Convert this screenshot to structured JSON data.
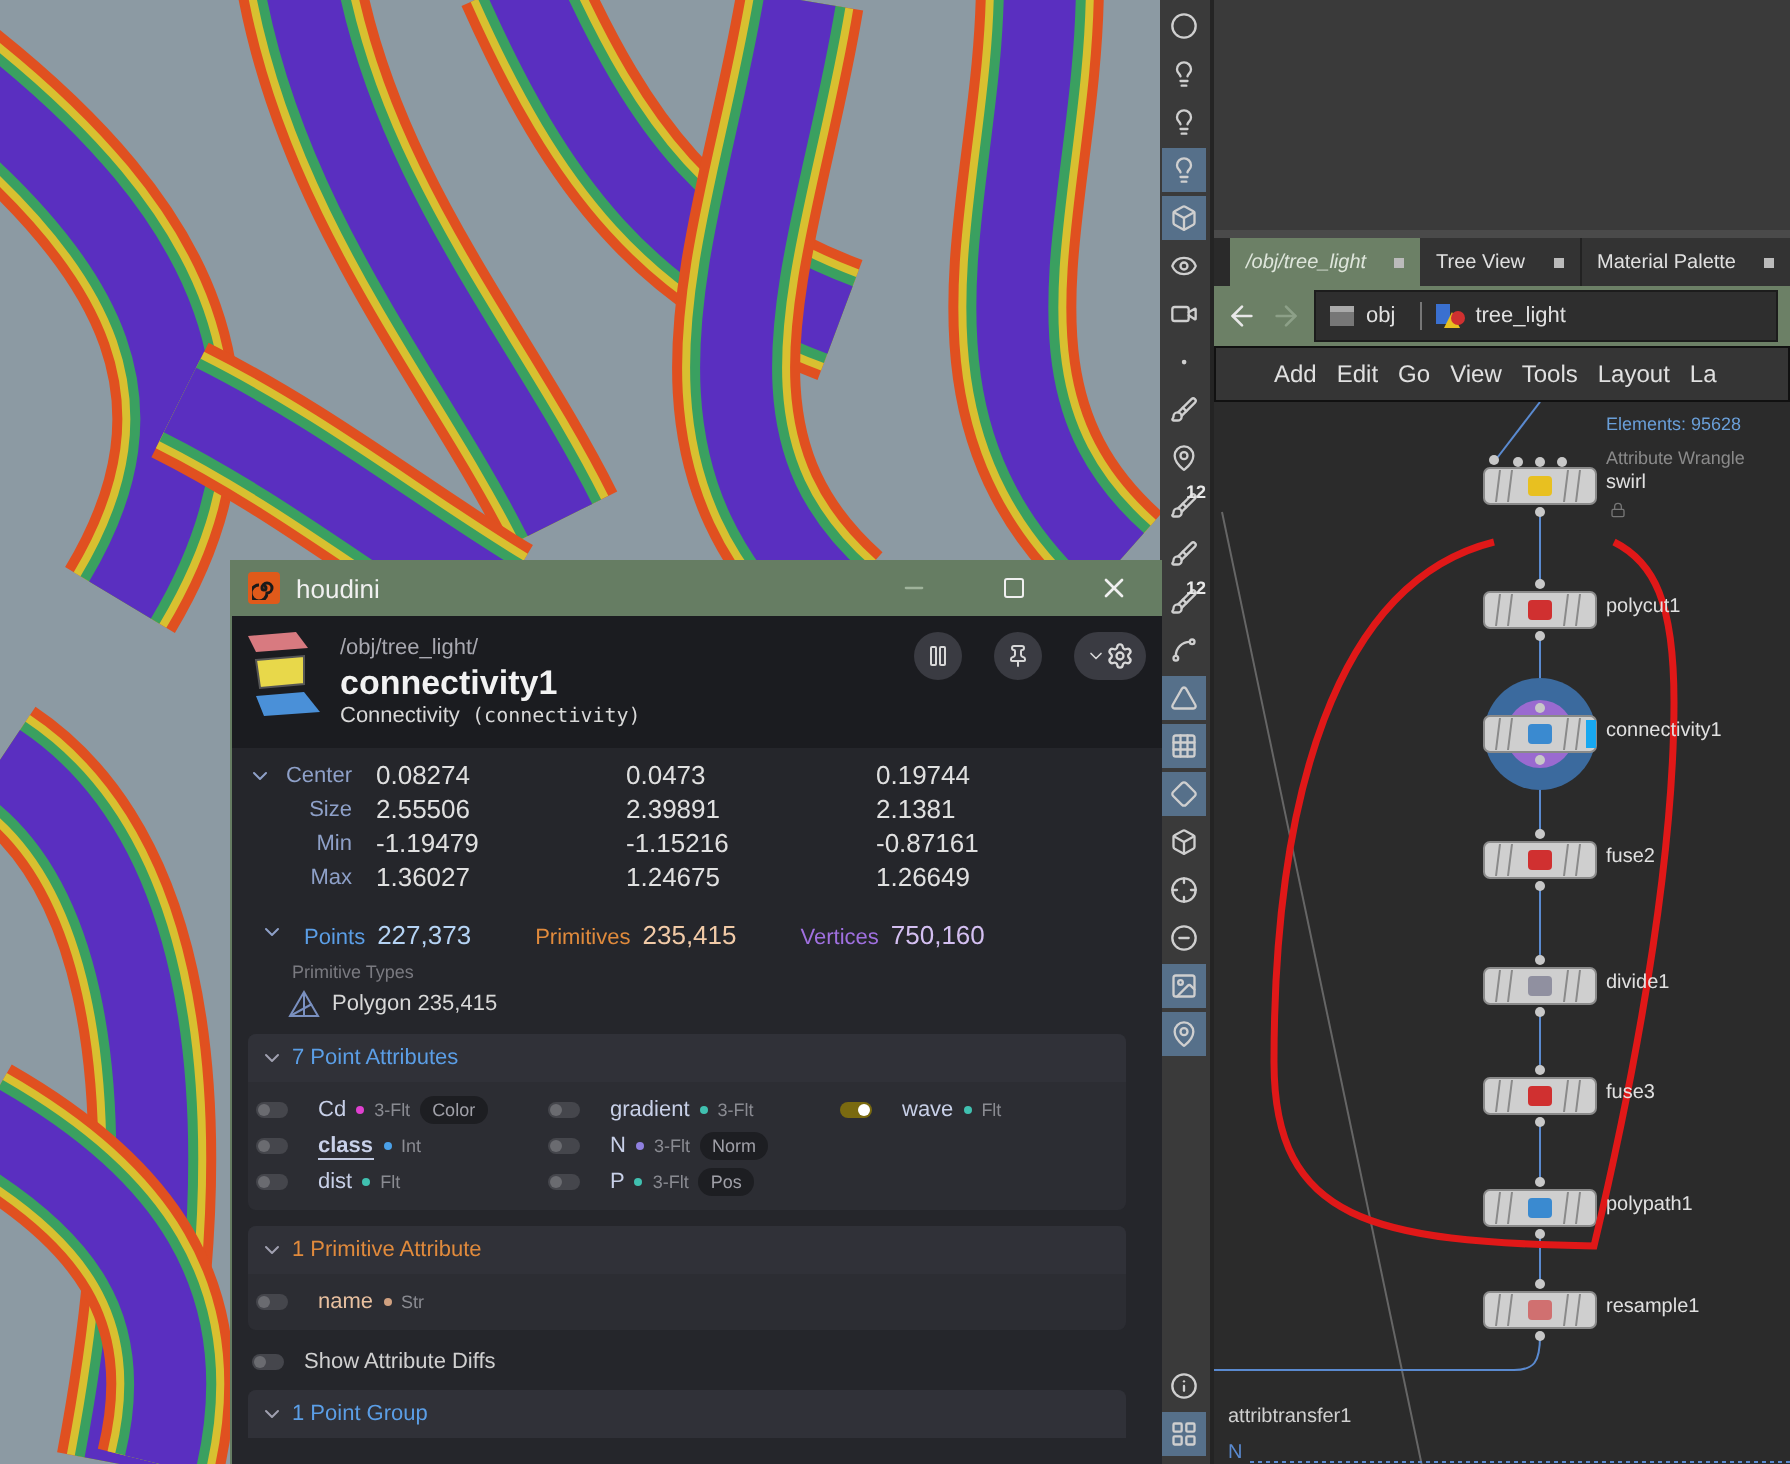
{
  "window": {
    "title": "houdini"
  },
  "node": {
    "path": "/obj/tree_light/",
    "name": "connectivity1",
    "type": "Connectivity",
    "internal": "(connectivity)"
  },
  "bounds": {
    "expanded": true,
    "rows": [
      {
        "label": "Center",
        "values": [
          "0.08274",
          "0.0473",
          "0.19744"
        ]
      },
      {
        "label": "Size",
        "values": [
          "2.55506",
          "2.39891",
          "2.1381"
        ]
      },
      {
        "label": "Min",
        "values": [
          "-1.19479",
          "-1.15216",
          "-0.87161"
        ]
      },
      {
        "label": "Max",
        "values": [
          "1.36027",
          "1.24675",
          "1.26649"
        ]
      }
    ]
  },
  "counts": [
    {
      "label": "Points",
      "value": "227,373",
      "color": "#5b9ee6"
    },
    {
      "label": "Primitives",
      "value": "235,415",
      "color": "#e08a3c"
    },
    {
      "label": "Vertices",
      "value": "750,160",
      "color": "#a070e0"
    }
  ],
  "primitive_types": {
    "heading": "Primitive Types",
    "items": [
      {
        "name": "Polygon",
        "count": "235,415"
      }
    ]
  },
  "attribute_sections": [
    {
      "title": "7 Point Attributes",
      "color": "#5b9ee6",
      "expanded": true,
      "attributes": [
        {
          "name": "Cd",
          "color": "#e040d0",
          "type": "3-Flt",
          "tag": "Color",
          "on": false,
          "selected": false
        },
        {
          "name": "class",
          "color": "#4aa0e8",
          "type": "Int",
          "on": false,
          "selected": true
        },
        {
          "name": "dist",
          "color": "#40c0b0",
          "type": "Flt",
          "on": false,
          "selected": false
        },
        {
          "name": "gradient",
          "color": "#40c0b0",
          "type": "3-Flt",
          "on": false,
          "selected": false
        },
        {
          "name": "N",
          "color": "#9080e0",
          "type": "3-Flt",
          "tag": "Norm",
          "on": false,
          "selected": false
        },
        {
          "name": "P",
          "color": "#40c0b0",
          "type": "3-Flt",
          "tag": "Pos",
          "on": false,
          "selected": false
        },
        {
          "name": "wave",
          "color": "#40c0b0",
          "type": "Flt",
          "on": true,
          "selected": false
        }
      ]
    },
    {
      "title": "1 Primitive Attribute",
      "color": "#e08a3c",
      "expanded": true,
      "attributes": [
        {
          "name": "name",
          "color": "#d0a080",
          "type": "Str",
          "on": false,
          "selected": false
        }
      ]
    }
  ],
  "show_attribute_diffs": {
    "label": "Show Attribute Diffs",
    "on": false
  },
  "groups": [
    {
      "title": "1 Point Group",
      "color": "#5b9ee6",
      "expanded": true
    }
  ],
  "side_toolbar": {
    "top": [
      {
        "kind": "sphere",
        "active": false
      },
      {
        "kind": "bulb",
        "active": false
      },
      {
        "kind": "bulb",
        "active": false
      },
      {
        "kind": "bulb",
        "active": true
      },
      {
        "kind": "box",
        "active": true
      },
      {
        "kind": "eye",
        "active": false
      },
      {
        "kind": "camera",
        "active": false
      },
      {
        "kind": "dot",
        "active": false
      },
      {
        "kind": "brush",
        "active": false
      },
      {
        "kind": "pin",
        "active": false
      },
      {
        "kind": "count",
        "text": "12",
        "active": false
      },
      {
        "kind": "brush",
        "active": false
      },
      {
        "kind": "count",
        "text": "12",
        "active": false
      },
      {
        "kind": "curve",
        "active": false
      },
      {
        "kind": "shape",
        "active": true
      },
      {
        "kind": "checker",
        "active": true
      },
      {
        "kind": "diamond",
        "active": true
      },
      {
        "kind": "box",
        "active": false
      },
      {
        "kind": "axis",
        "active": false
      },
      {
        "kind": "circle",
        "active": false
      },
      {
        "kind": "image",
        "active": true
      },
      {
        "kind": "pin",
        "active": true
      }
    ],
    "bottom": [
      {
        "kind": "info",
        "active": false
      },
      {
        "kind": "grid",
        "active": true
      }
    ]
  },
  "pane_tabs": [
    {
      "label": "/obj/tree_light",
      "selected": true
    },
    {
      "label": "Tree View",
      "selected": false
    },
    {
      "label": "Material Palette",
      "selected": false
    }
  ],
  "path": [
    "obj",
    "tree_light"
  ],
  "menu": [
    "Add",
    "Edit",
    "Go",
    "View",
    "Tools",
    "Layout",
    "La"
  ],
  "network": {
    "info": "Elements: 95628",
    "nodes": [
      {
        "name": "swirl",
        "type_label": "Attribute Wrangle",
        "selected": false,
        "locked": true
      },
      {
        "name": "polycut1",
        "selected": false,
        "locked": false
      },
      {
        "name": "connectivity1",
        "selected": true,
        "locked": false
      },
      {
        "name": "fuse2",
        "selected": false,
        "locked": false
      },
      {
        "name": "divide1",
        "selected": false,
        "locked": false
      },
      {
        "name": "fuse3",
        "selected": false,
        "locked": false
      },
      {
        "name": "polypath1",
        "selected": false,
        "locked": false
      },
      {
        "name": "resample1",
        "selected": false,
        "locked": false
      }
    ],
    "labels": [
      "attribtransfer1",
      "N"
    ]
  }
}
